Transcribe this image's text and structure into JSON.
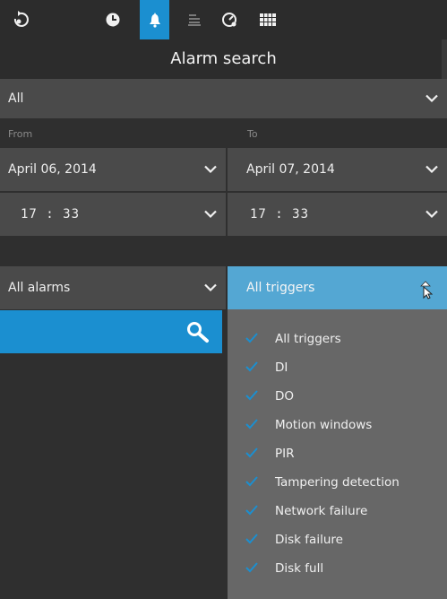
{
  "toolbar": {
    "icons": [
      "rotate-icon",
      "clock-icon",
      "alarm-bell-icon",
      "storage-icon",
      "dashboard-icon",
      "grid-icon"
    ],
    "active": "alarm-bell-icon"
  },
  "header": {
    "title": "Alarm search"
  },
  "filter": {
    "value": "All"
  },
  "range": {
    "from_label": "From",
    "to_label": "To",
    "from_date": "April 06, 2014",
    "to_date": "April 07, 2014",
    "from_time": "17 : 33",
    "to_time": "17 : 33"
  },
  "alarms": {
    "value": "All alarms"
  },
  "triggers": {
    "value": "All triggers",
    "options": [
      "All triggers",
      "DI",
      "DO",
      "Motion windows",
      "PIR",
      "Tampering detection",
      "Network failure",
      "Disk failure",
      "Disk full"
    ]
  },
  "colors": {
    "accent": "#1b8fd0",
    "accent_light": "#54a7d3",
    "check": "#1b8fd0"
  }
}
